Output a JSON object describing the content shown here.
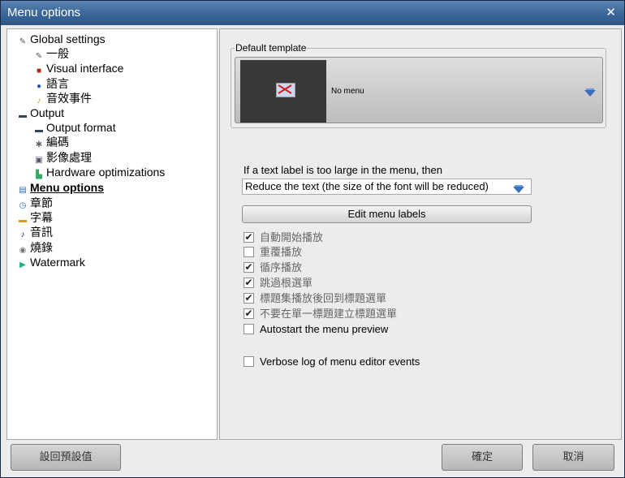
{
  "window": {
    "title": "Menu options",
    "close_glyph": "✕"
  },
  "tree": [
    {
      "label": "Global settings",
      "icon": "wrench-icon",
      "glyph": "✎",
      "color": "#555"
    },
    {
      "label": "一般",
      "icon": "wrench-icon",
      "glyph": "✎",
      "color": "#555"
    },
    {
      "label": "Visual interface",
      "icon": "paint-icon",
      "glyph": "■",
      "color": "#b22"
    },
    {
      "label": "語言",
      "icon": "globe-icon",
      "glyph": "●",
      "color": "#2358b8"
    },
    {
      "label": "音效事件",
      "icon": "sound-event-icon",
      "glyph": "♪",
      "color": "#b8a020"
    },
    {
      "label": "Output",
      "icon": "monitor-icon",
      "glyph": "▬",
      "color": "#345"
    },
    {
      "label": "Output format",
      "icon": "monitor-icon",
      "glyph": "▬",
      "color": "#345"
    },
    {
      "label": "編碼",
      "icon": "gear-icon",
      "glyph": "✱",
      "color": "#666"
    },
    {
      "label": "影像處理",
      "icon": "image-process-icon",
      "glyph": "▣",
      "color": "#556"
    },
    {
      "label": "Hardware optimizations",
      "icon": "hardware-icon",
      "glyph": "▙",
      "color": "#3a6"
    },
    {
      "label": "Menu options",
      "icon": "menu-icon",
      "glyph": "▤",
      "color": "#2a66b8",
      "selected": true
    },
    {
      "label": "章節",
      "icon": "clock-icon",
      "glyph": "◷",
      "color": "#2a66b8"
    },
    {
      "label": "字幕",
      "icon": "subtitle-icon",
      "glyph": "▬",
      "color": "#d8a000"
    },
    {
      "label": "音訊",
      "icon": "music-note-icon",
      "glyph": "♪",
      "color": "#225"
    },
    {
      "label": "燒錄",
      "icon": "disc-icon",
      "glyph": "◉",
      "color": "#777"
    },
    {
      "label": "Watermark",
      "icon": "watermark-icon",
      "glyph": "▶",
      "color": "#2a8"
    }
  ],
  "right": {
    "template_group_label": "Default template",
    "template_name": "No menu",
    "label_question": "If a text label is too large in the menu, then",
    "label_combo_value": "Reduce the text (the size of the font will be reduced)",
    "edit_labels_button": "Edit menu labels",
    "checkboxes": [
      {
        "label": "自動開始播放",
        "checked": true,
        "dim": true
      },
      {
        "label": "重覆播放",
        "checked": false,
        "dim": true
      },
      {
        "label": "循序播放",
        "checked": true,
        "dim": true
      },
      {
        "label": "跳過根選單",
        "checked": true,
        "dim": true
      },
      {
        "label": "標題集播放後回到標題選單",
        "checked": true,
        "dim": true
      },
      {
        "label": "不要在單一標題建立標題選單",
        "checked": true,
        "dim": true
      },
      {
        "label": "Autostart the menu preview",
        "checked": false,
        "dim": false
      },
      {
        "label": "Verbose log of menu editor events",
        "checked": false,
        "dim": false
      }
    ]
  },
  "footer": {
    "reset_button": "設回預設值",
    "ok_button": "確定",
    "cancel_button": "取消"
  },
  "colors": {
    "titlebar": "#3f6a9c",
    "arrow": "#3a6fc0"
  }
}
